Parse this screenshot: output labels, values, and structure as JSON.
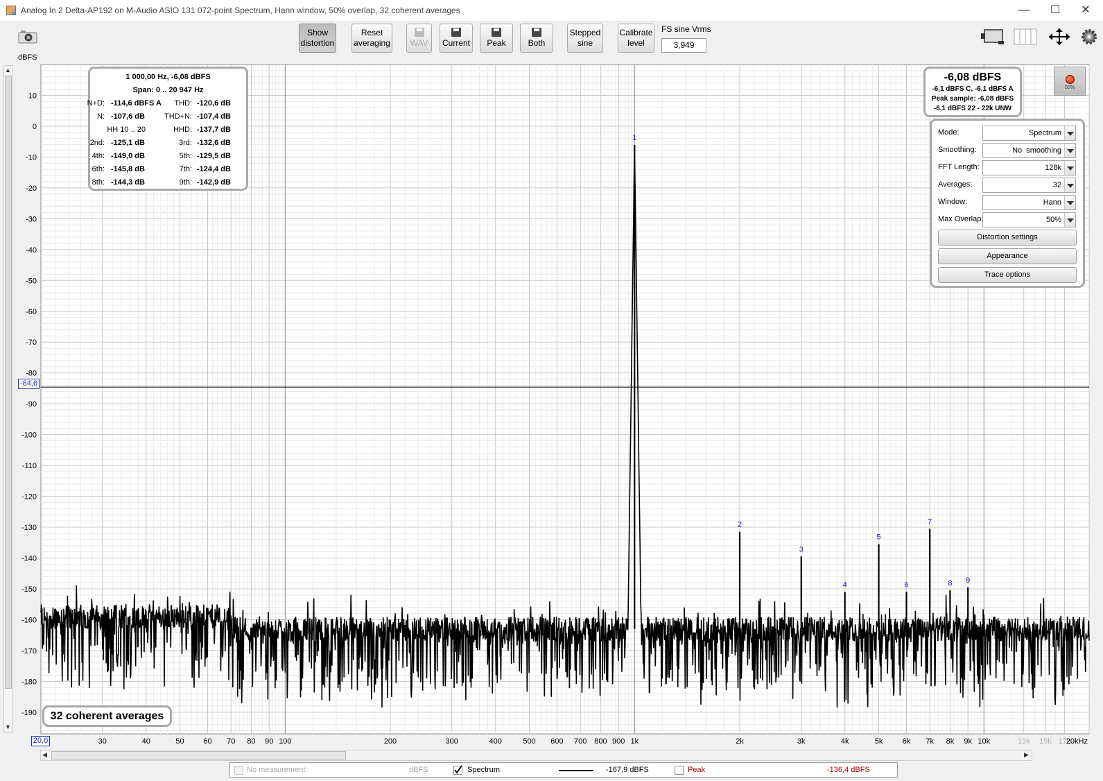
{
  "window": {
    "title": "Analog In 2 Delta-AP192 on M-Audio ASIO 131 072-point Spectrum, Hann window, 50% overlap, 32 coherent averages",
    "minimize": "—",
    "maximize": "☐",
    "close": "✕"
  },
  "toolbar": {
    "show_distortion": [
      "Show",
      "distortion"
    ],
    "reset_averaging": [
      "Reset",
      "averaging"
    ],
    "wav": "WAV",
    "current": "Current",
    "peak": "Peak",
    "both": "Both",
    "stepped_sine": [
      "Stepped",
      "sine"
    ],
    "calibrate_level": [
      "Calibrate",
      "level"
    ],
    "fs_label": "FS sine Vrms",
    "fs_value": "3,949"
  },
  "plot": {
    "y_unit": "dBFS",
    "cursor_y": "-84,6",
    "x_start": "20,0",
    "colors": {
      "grid": "#c8c8c8",
      "trace": "#000000",
      "marker": "#1a1aaa",
      "tick_faded": "#b0b0b0"
    }
  },
  "distortion_box": {
    "header1": "1 000,00 Hz, -6,08 dBFS",
    "header2": "Span: 0 .. 20 947 Hz",
    "rows": [
      {
        "l1": "N+D:",
        "v1": "-114,6 dBFS A",
        "l2": "THD:",
        "v2": "-120,6 dB"
      },
      {
        "l1": "N:",
        "v1": "-107,6 dB",
        "l2": "THD+N:",
        "v2": "-107,4 dB"
      },
      {
        "l1": "HH 10 .. 20",
        "v1": "",
        "l2": "HHD:",
        "v2": "-137,7 dB"
      },
      {
        "l1": "2nd:",
        "v1": "-125,1 dB",
        "l2": "3rd:",
        "v2": "-132,6 dB"
      },
      {
        "l1": "4th:",
        "v1": "-149,0 dB",
        "l2": "5th:",
        "v2": "-129,5 dB"
      },
      {
        "l1": "6th:",
        "v1": "-145,8 dB",
        "l2": "7th:",
        "v2": "-124,4 dB"
      },
      {
        "l1": "8th:",
        "v1": "-144,3 dB",
        "l2": "9th:",
        "v2": "-142,9 dB"
      }
    ]
  },
  "level_box": {
    "main": "-6,08 dBFS",
    "line1": "-6,1 dBFS C, -6,1 dBFS A",
    "line2": "Peak sample: -6,08 dBFS",
    "line3": "-6,1 dBFS 22 - 22k UNW"
  },
  "record_button": {
    "percent": "50%"
  },
  "controls": {
    "mode": {
      "label": "Mode:",
      "value": "Spectrum"
    },
    "smoothing": {
      "label": "Smoothing:",
      "value": "No  smoothing"
    },
    "fft_length": {
      "label": "FFT Length:",
      "value": "128k"
    },
    "averages": {
      "label": "Averages:",
      "value": "32"
    },
    "window": {
      "label": "Window:",
      "value": "Hann"
    },
    "max_overlap": {
      "label": "Max Overlap:",
      "value": "50%"
    },
    "distortion_settings": "Distortion settings",
    "appearance": "Appearance",
    "trace_options": "Trace options"
  },
  "averages_badge": "32 coherent averages",
  "legend": {
    "no_measurement": "No measurement",
    "no_measurement_unit": "dBFS",
    "spectrum": "Spectrum",
    "spectrum_value": "-167,9 dBFS",
    "peak": "Peak",
    "peak_value": "-136,4 dBFS",
    "peak_color": "#b00000"
  },
  "chart_data": {
    "type": "line",
    "title": "",
    "xlabel": "",
    "ylabel": "dBFS",
    "x_scale": "log",
    "xlim": [
      20,
      20000
    ],
    "ylim": [
      -197,
      20
    ],
    "y_ticks": [
      10,
      0,
      -10,
      -20,
      -30,
      -40,
      -50,
      -60,
      -70,
      -80,
      -90,
      -100,
      -110,
      -120,
      -130,
      -140,
      -150,
      -160,
      -170,
      -180,
      -190
    ],
    "x_ticks": [
      {
        "v": 30,
        "t": "30"
      },
      {
        "v": 40,
        "t": "40"
      },
      {
        "v": 50,
        "t": "50"
      },
      {
        "v": 60,
        "t": "60"
      },
      {
        "v": 70,
        "t": "70"
      },
      {
        "v": 80,
        "t": "80"
      },
      {
        "v": 90,
        "t": "90"
      },
      {
        "v": 100,
        "t": "100"
      },
      {
        "v": 200,
        "t": "200"
      },
      {
        "v": 300,
        "t": "300"
      },
      {
        "v": 400,
        "t": "400"
      },
      {
        "v": 500,
        "t": "500"
      },
      {
        "v": 600,
        "t": "600"
      },
      {
        "v": 700,
        "t": "700"
      },
      {
        "v": 800,
        "t": "800"
      },
      {
        "v": 900,
        "t": "900"
      },
      {
        "v": 1000,
        "t": "1k"
      },
      {
        "v": 2000,
        "t": "2k"
      },
      {
        "v": 3000,
        "t": "3k"
      },
      {
        "v": 4000,
        "t": "4k"
      },
      {
        "v": 5000,
        "t": "5k"
      },
      {
        "v": 6000,
        "t": "6k"
      },
      {
        "v": 7000,
        "t": "7k"
      },
      {
        "v": 8000,
        "t": "8k"
      },
      {
        "v": 9000,
        "t": "9k"
      },
      {
        "v": 10000,
        "t": "10k"
      },
      {
        "v": 13000,
        "t": "13k",
        "faded": true
      },
      {
        "v": 15000,
        "t": "15k",
        "faded": true
      },
      {
        "v": 17000,
        "t": "17k",
        "faded": true
      },
      {
        "v": 20000,
        "t": "20kHz"
      }
    ],
    "cursor_level": -84.6,
    "noise_floor": -163,
    "peaks": [
      {
        "label": "1",
        "freq": 1000,
        "level": -6.08
      },
      {
        "label": "2",
        "freq": 2000,
        "level": -131.5
      },
      {
        "label": "3",
        "freq": 3000,
        "level": -139.5
      },
      {
        "label": "4",
        "freq": 4000,
        "level": -151
      },
      {
        "label": "5",
        "freq": 5000,
        "level": -135.5
      },
      {
        "label": "6",
        "freq": 6000,
        "level": -151
      },
      {
        "label": "7",
        "freq": 7000,
        "level": -130.5
      },
      {
        "label": "8",
        "freq": 8000,
        "level": -150.5
      },
      {
        "label": "9",
        "freq": 9000,
        "level": -149.5
      }
    ]
  }
}
